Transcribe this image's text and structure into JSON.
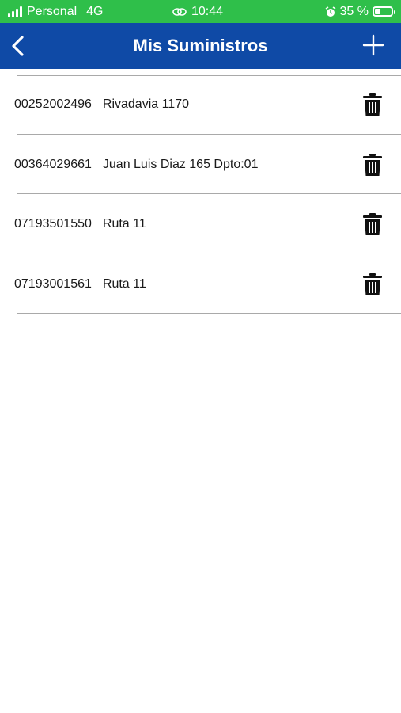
{
  "status_bar": {
    "carrier": "Personal",
    "network": "4G",
    "time": "10:44",
    "battery": "35 %",
    "battery_level": 0.35,
    "color": "#2fbf4a"
  },
  "header": {
    "title": "Mis Suministros",
    "color": "#0f4aa6",
    "back_icon": "chevron-left-icon",
    "add_icon": "plus-icon"
  },
  "suministros": [
    {
      "numero": "00252002496",
      "direccion": "Rivadavia 1170"
    },
    {
      "numero": "00364029661",
      "direccion": "Juan Luis Diaz 165 Dpto:01"
    },
    {
      "numero": "07193501550",
      "direccion": "Ruta 11"
    },
    {
      "numero": "07193001561",
      "direccion": "Ruta 11"
    }
  ]
}
